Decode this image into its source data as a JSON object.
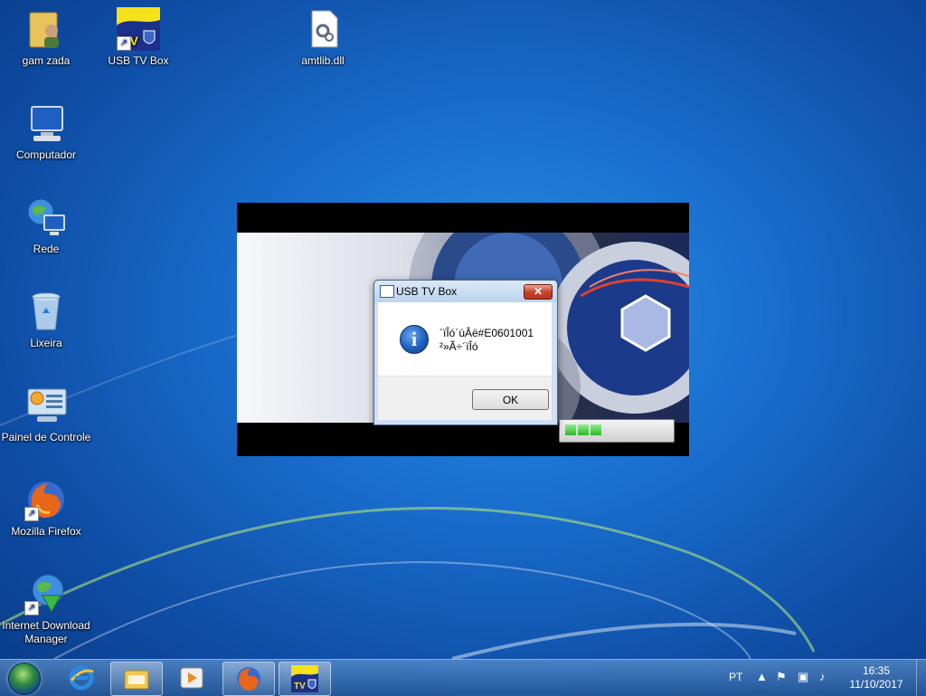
{
  "desktop": {
    "icons": [
      {
        "label": "gam zada"
      },
      {
        "label": "USB TV Box"
      },
      {
        "label": "amtlib.dll"
      },
      {
        "label": "Computador"
      },
      {
        "label": "Rede"
      },
      {
        "label": "Lixeira"
      },
      {
        "label": "Painel de Controle"
      },
      {
        "label": "Mozilla Firefox"
      },
      {
        "label": "Internet Download Manager"
      }
    ]
  },
  "splash": {
    "progress_percent": 40
  },
  "dialog": {
    "title": "USB TV Box",
    "close_glyph": "✕",
    "message_line1": "´ïÎó´úÂë#E0601001",
    "message_line2": "²»Ã÷´ïÎó",
    "ok_label": "OK",
    "icon": "information-icon"
  },
  "taskbar": {
    "buttons": [
      {
        "name": "internet-explorer"
      },
      {
        "name": "windows-explorer"
      },
      {
        "name": "windows-media-player"
      },
      {
        "name": "firefox"
      },
      {
        "name": "usb-tv-box"
      }
    ],
    "language": "PT",
    "time": "16:35",
    "date": "11/10/2017"
  }
}
